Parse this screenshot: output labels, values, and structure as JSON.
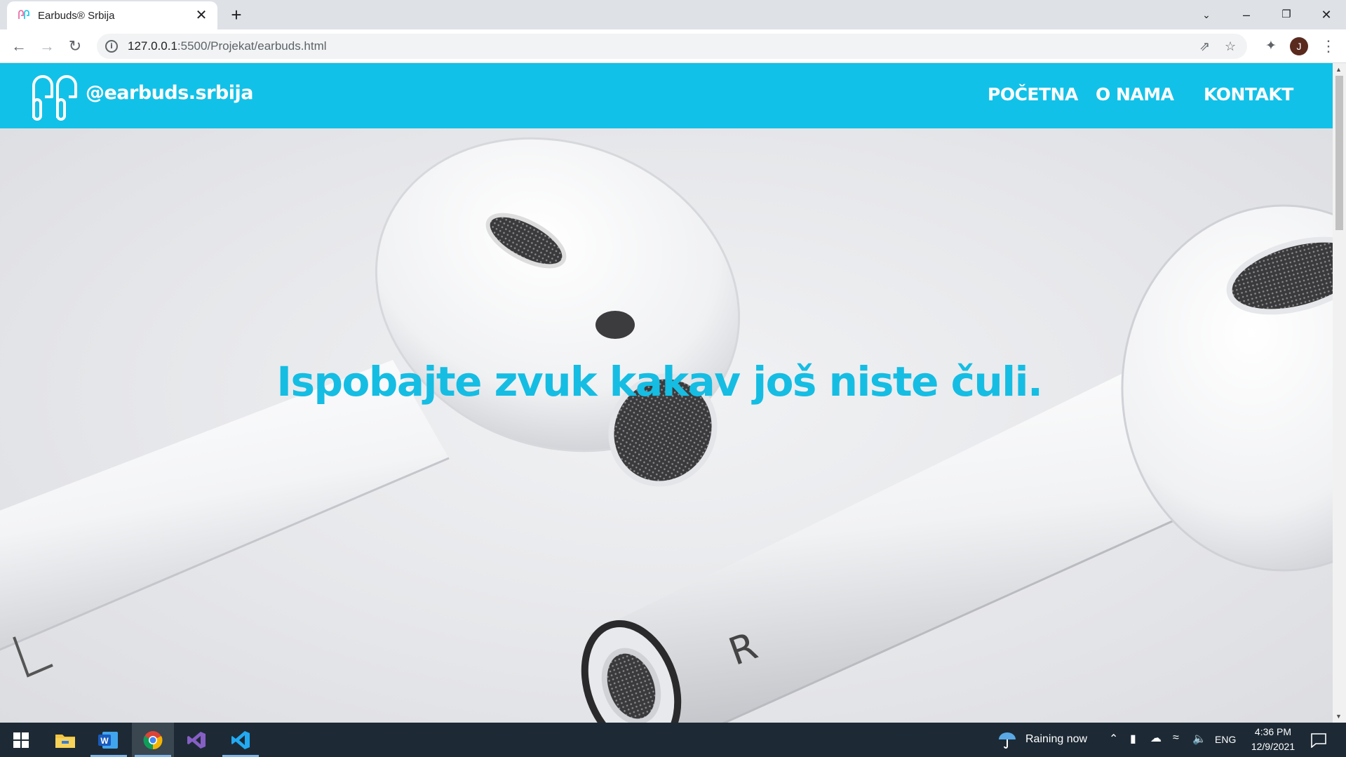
{
  "browser": {
    "tab_title": "Earbuds® Srbija",
    "tab_close": "✕",
    "new_tab": "+",
    "url_host": "127.0.0.1",
    "url_rest": ":5500/Projekat/earbuds.html",
    "avatar_initial": "J",
    "icons": [
      "back-arrow-icon",
      "forward-arrow-icon",
      "reload-icon",
      "info-icon",
      "share-icon",
      "star-icon",
      "puzzle-icon",
      "kebab-menu-icon"
    ]
  },
  "site": {
    "logo_text": "@earbuds.srbija",
    "nav": [
      "POČETNA",
      "O NAMA",
      "KONTAKT"
    ],
    "headline": "Ispobajte zvuk kakav još niste čuli.",
    "colors": {
      "header": "#12c1e8",
      "headline": "#15bde3"
    },
    "earbud_letters": [
      "L",
      "R"
    ]
  },
  "taskbar": {
    "weather": "Raining now",
    "language": "ENG",
    "time": "4:36 PM",
    "date": "12/9/2021",
    "apps": [
      "windows-start-icon",
      "file-explorer-icon",
      "word-icon",
      "chrome-icon",
      "visual-studio-icon",
      "vscode-icon"
    ]
  }
}
